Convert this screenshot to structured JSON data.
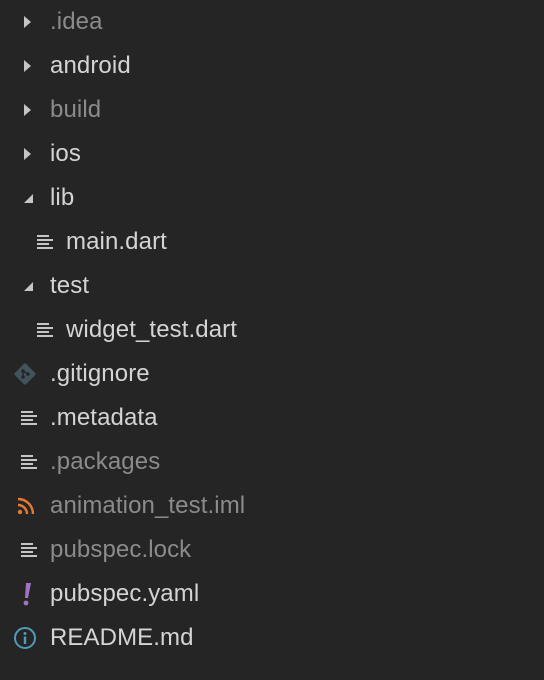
{
  "explorer": {
    "items": [
      {
        "label": ".idea",
        "kind": "folder-collapsed",
        "icon": "chevron-right-icon",
        "dimmed": true
      },
      {
        "label": "android",
        "kind": "folder-collapsed",
        "icon": "chevron-right-icon",
        "dimmed": false
      },
      {
        "label": "build",
        "kind": "folder-collapsed",
        "icon": "chevron-right-icon",
        "dimmed": true
      },
      {
        "label": "ios",
        "kind": "folder-collapsed",
        "icon": "chevron-right-icon",
        "dimmed": false
      },
      {
        "label": "lib",
        "kind": "folder-expanded",
        "icon": "chevron-down-icon",
        "dimmed": false
      },
      {
        "label": "main.dart",
        "kind": "file",
        "icon": "file-lines-icon",
        "dimmed": false
      },
      {
        "label": "test",
        "kind": "folder-expanded",
        "icon": "chevron-down-icon",
        "dimmed": false
      },
      {
        "label": "widget_test.dart",
        "kind": "file",
        "icon": "file-lines-icon",
        "dimmed": false
      },
      {
        "label": ".gitignore",
        "kind": "file",
        "icon": "git-icon",
        "dimmed": false
      },
      {
        "label": ".metadata",
        "kind": "file",
        "icon": "file-lines-icon",
        "dimmed": false
      },
      {
        "label": ".packages",
        "kind": "file",
        "icon": "file-lines-icon",
        "dimmed": true
      },
      {
        "label": "animation_test.iml",
        "kind": "file",
        "icon": "rss-icon",
        "dimmed": true
      },
      {
        "label": "pubspec.lock",
        "kind": "file",
        "icon": "file-lines-icon",
        "dimmed": true
      },
      {
        "label": "pubspec.yaml",
        "kind": "file",
        "icon": "exclamation-icon",
        "dimmed": false
      },
      {
        "label": "README.md",
        "kind": "file",
        "icon": "info-icon",
        "dimmed": false
      }
    ]
  },
  "colors": {
    "background": "#252526",
    "text": "#d4d4d4",
    "text_dimmed": "#8b8b8b",
    "icon_gray": "#c5c5c5",
    "git": "#41535b",
    "rss": "#e37933",
    "yaml": "#a074c4",
    "info": "#519aba"
  }
}
